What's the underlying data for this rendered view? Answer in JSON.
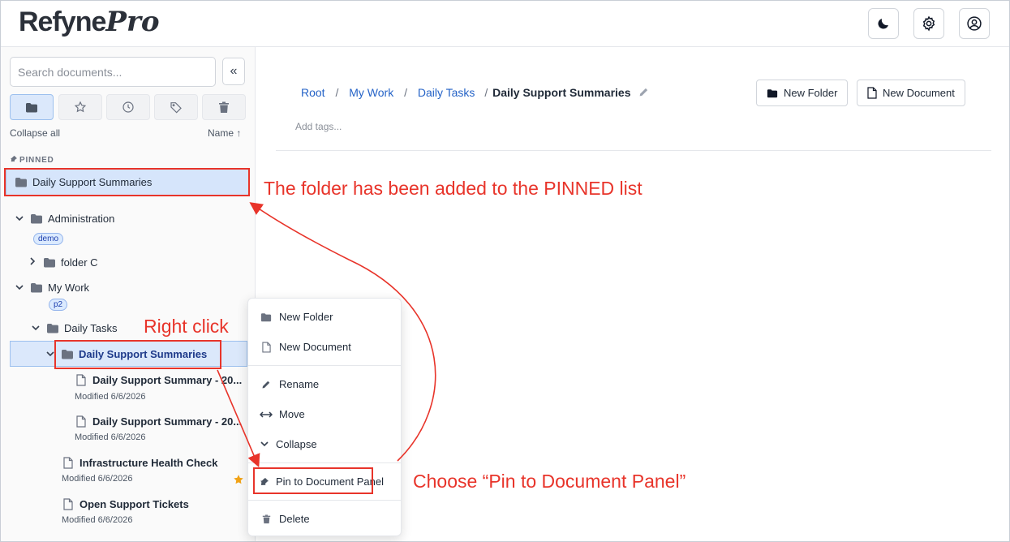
{
  "app": {
    "logo_main": "Refyne",
    "logo_accent": "Pro"
  },
  "header": {
    "icons": [
      "moon-icon",
      "gear-icon",
      "user-icon"
    ]
  },
  "sidebar": {
    "search_placeholder": "Search documents...",
    "collapse_glyph": "«",
    "filter_tabs": [
      "folder-icon",
      "star-icon",
      "clock-icon",
      "tag-icon",
      "trash-icon"
    ],
    "collapse_all": "Collapse all",
    "sort_label": "Name ↑",
    "pinned_heading": "PINNED",
    "pinned_items": [
      {
        "label": "Daily Support Summaries"
      }
    ],
    "tree": {
      "administration": {
        "label": "Administration",
        "tag": "demo"
      },
      "folder_c": {
        "label": "folder C"
      },
      "my_work": {
        "label": "My Work",
        "tag": "p2"
      },
      "daily_tasks": {
        "label": "Daily Tasks"
      },
      "daily_support_summaries": {
        "label": "Daily Support Summaries"
      },
      "documents": [
        {
          "title": "Daily Support Summary - 20...",
          "modified": "Modified 6/6/2026"
        },
        {
          "title": "Daily Support Summary - 20...",
          "modified": "Modified 6/6/2026"
        },
        {
          "title": "Infrastructure Health Check",
          "modified": "Modified 6/6/2026",
          "starred": true
        },
        {
          "title": "Open Support Tickets",
          "modified": "Modified 6/6/2026"
        }
      ]
    }
  },
  "main": {
    "breadcrumb": {
      "items": [
        "Root",
        "My Work",
        "Daily Tasks"
      ],
      "separator": "/",
      "current": "Daily Support Summaries"
    },
    "add_tags_placeholder": "Add tags...",
    "new_folder_label": "New Folder",
    "new_document_label": "New Document"
  },
  "context_menu": {
    "items": [
      "New Folder",
      "New Document",
      "Rename",
      "Move",
      "Collapse",
      "Pin to Document Panel",
      "Delete"
    ]
  },
  "annotations": {
    "pinned_note": "The folder has been added to the PINNED list",
    "right_click_note": "Right click",
    "choose_note": "Choose “Pin to Document Panel”",
    "color": "#e8342a"
  },
  "colors": {
    "link": "#2563c7",
    "selection_bg": "#dbe8fb",
    "star": "#f2a316"
  }
}
